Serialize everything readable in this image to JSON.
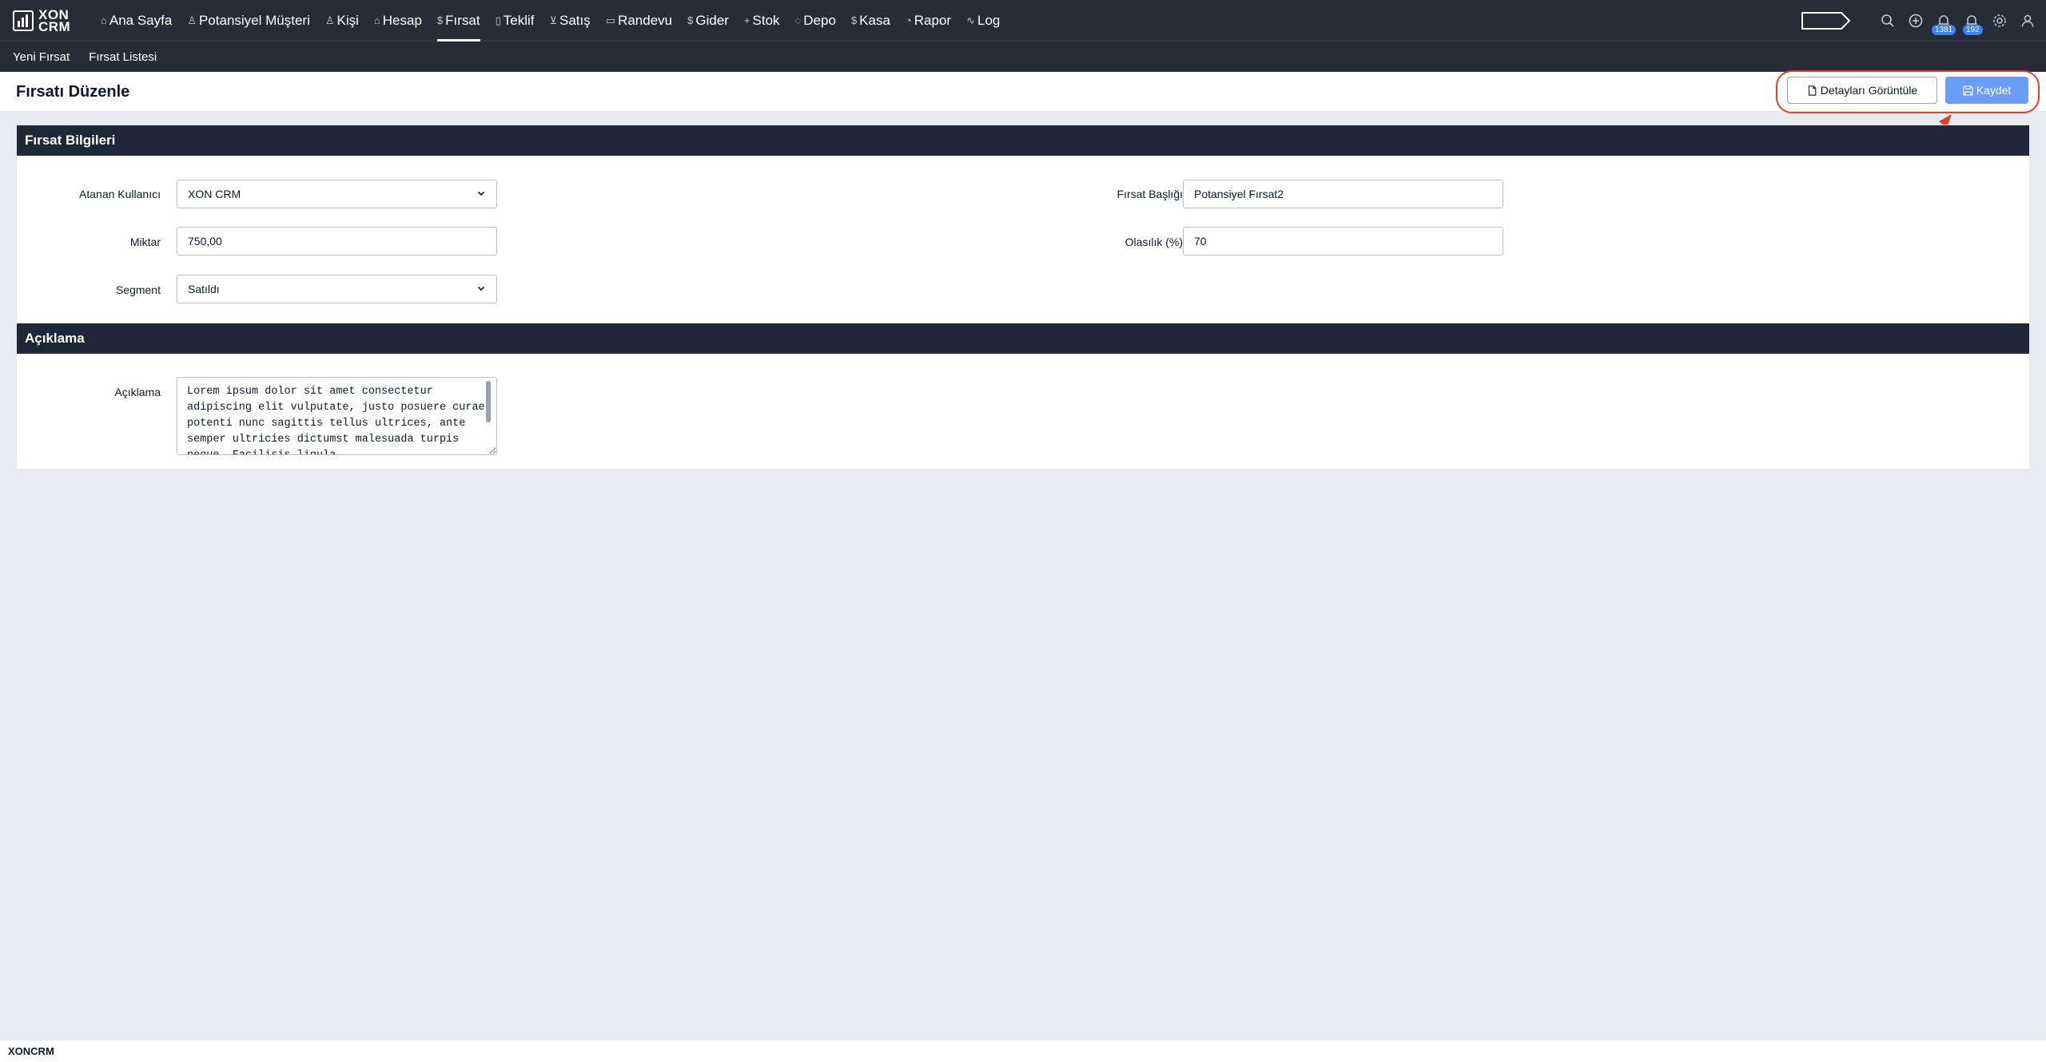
{
  "app": {
    "logo_line1": "XON",
    "logo_line2": "CRM"
  },
  "nav": {
    "items": [
      {
        "label": "Ana Sayfa",
        "icon": "home-icon",
        "glyph": "⌂"
      },
      {
        "label": "Potansiyel Müşteri",
        "icon": "user-icon",
        "glyph": "♙"
      },
      {
        "label": "Kişi",
        "icon": "users-icon",
        "glyph": "♙"
      },
      {
        "label": "Hesap",
        "icon": "building-icon",
        "glyph": "⌂"
      },
      {
        "label": "Fırsat",
        "icon": "dollar-icon",
        "glyph": "$",
        "active": true
      },
      {
        "label": "Teklif",
        "icon": "file-icon",
        "glyph": "▯"
      },
      {
        "label": "Satış",
        "icon": "cart-icon",
        "glyph": "⊻"
      },
      {
        "label": "Randevu",
        "icon": "calendar-icon",
        "glyph": "▭"
      },
      {
        "label": "Gider",
        "icon": "dollar-icon",
        "glyph": "$"
      },
      {
        "label": "Stok",
        "icon": "plus-icon",
        "glyph": "+"
      },
      {
        "label": "Depo",
        "icon": "box-icon",
        "glyph": "◌"
      },
      {
        "label": "Kasa",
        "icon": "dollar-icon",
        "glyph": "$"
      },
      {
        "label": "Rapor",
        "icon": "pie-icon",
        "glyph": "◔"
      },
      {
        "label": "Log",
        "icon": "activity-icon",
        "glyph": "∿"
      }
    ],
    "notifications_count": "1381",
    "alerts_count": "192"
  },
  "subnav": {
    "new_label": "Yeni Fırsat",
    "list_label": "Fırsat Listesi"
  },
  "page": {
    "title": "Fırsatı Düzenle",
    "detail_button": "Detayları Görüntüle",
    "save_button": "Kaydet"
  },
  "section1": {
    "title": "Fırsat Bilgileri",
    "assigned_user_label": "Atanan Kullanıcı",
    "assigned_user_value": "XON CRM",
    "amount_label": "Miktar",
    "amount_value": "750,00",
    "segment_label": "Segment",
    "segment_value": "Satıldı",
    "opp_title_label": "Fırsat Başlığı",
    "opp_title_value": "Potansiyel Fırsat2",
    "probability_label": "Olasılık (%)",
    "probability_value": "70"
  },
  "section2": {
    "title": "Açıklama",
    "description_label": "Açıklama",
    "description_value": "Lorem ipsum dolor sit amet consectetur adipiscing elit vulputate, justo posuere curae potenti nunc sagittis tellus ultrices, ante semper ultricies dictumst malesuada turpis neque. Facilisis ligula"
  },
  "footer": {
    "brand": "XONCRM"
  },
  "colors": {
    "nav_bg": "#272c38",
    "section_bg": "#1f2638",
    "save_bg": "#6b9cf6",
    "highlight": "#e0402a"
  }
}
